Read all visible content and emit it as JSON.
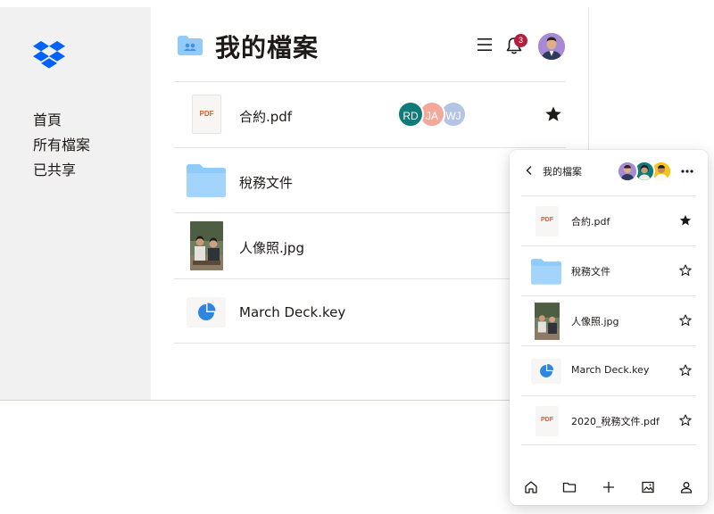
{
  "sidebar": {
    "nav": [
      {
        "label": "首頁"
      },
      {
        "label": "所有檔案"
      },
      {
        "label": "已共享"
      }
    ]
  },
  "header": {
    "title": "我的檔案",
    "notification_count": "3"
  },
  "files": [
    {
      "name": "合約.pdf",
      "type": "pdf",
      "thumb_label": "PDF",
      "starred": true,
      "collaborators": [
        {
          "initials": "RD",
          "color": "#0e7a7a"
        },
        {
          "initials": "JA",
          "color": "#f2a89b"
        },
        {
          "initials": "WJ",
          "color": "#b4c4e4"
        }
      ]
    },
    {
      "name": "稅務文件",
      "type": "folder"
    },
    {
      "name": "人像照.jpg",
      "type": "image"
    },
    {
      "name": "March Deck.key",
      "type": "keynote"
    }
  ],
  "mobile": {
    "title": "我的檔案",
    "files": [
      {
        "name": "合約.pdf",
        "type": "pdf",
        "thumb_label": "PDF",
        "starred": true
      },
      {
        "name": "稅務文件",
        "type": "folder",
        "starred": false
      },
      {
        "name": "人像照.jpg",
        "type": "image",
        "starred": false
      },
      {
        "name": "March Deck.key",
        "type": "keynote",
        "starred": false
      },
      {
        "name": "2020_稅務文件.pdf",
        "type": "pdf",
        "thumb_label": "PDF",
        "starred": false
      }
    ],
    "tabs": [
      "home-icon",
      "folder-icon",
      "plus-icon",
      "photos-icon",
      "account-icon"
    ]
  },
  "colors": {
    "brand_blue": "#0061fe",
    "folder_blue": "#8fcbfb",
    "sidebar_bg": "#f2f1f1",
    "pdf_red": "#e0582b",
    "badge_red": "#b11f3c"
  }
}
